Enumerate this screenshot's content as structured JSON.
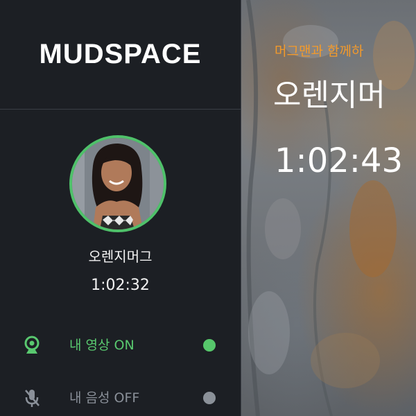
{
  "sidebar": {
    "logo": "MUDSPACE",
    "profile": {
      "name": "오렌지머그",
      "time": "1:02:32"
    },
    "menu": [
      {
        "label": "내 영상 ON",
        "icon": "webcam-icon",
        "status": "on",
        "status_color": "#56c76b"
      },
      {
        "label": "내 음성 OFF",
        "icon": "microphone-off-icon",
        "status": "off",
        "status_color": "#8b9199"
      }
    ]
  },
  "main": {
    "greeting": "머그맨과 함께하",
    "name": "오렌지머",
    "time": "1:02:43"
  },
  "colors": {
    "accent_green": "#4fc16a",
    "accent_orange": "#f39a2b",
    "sidebar_bg": "#1c1f24"
  }
}
